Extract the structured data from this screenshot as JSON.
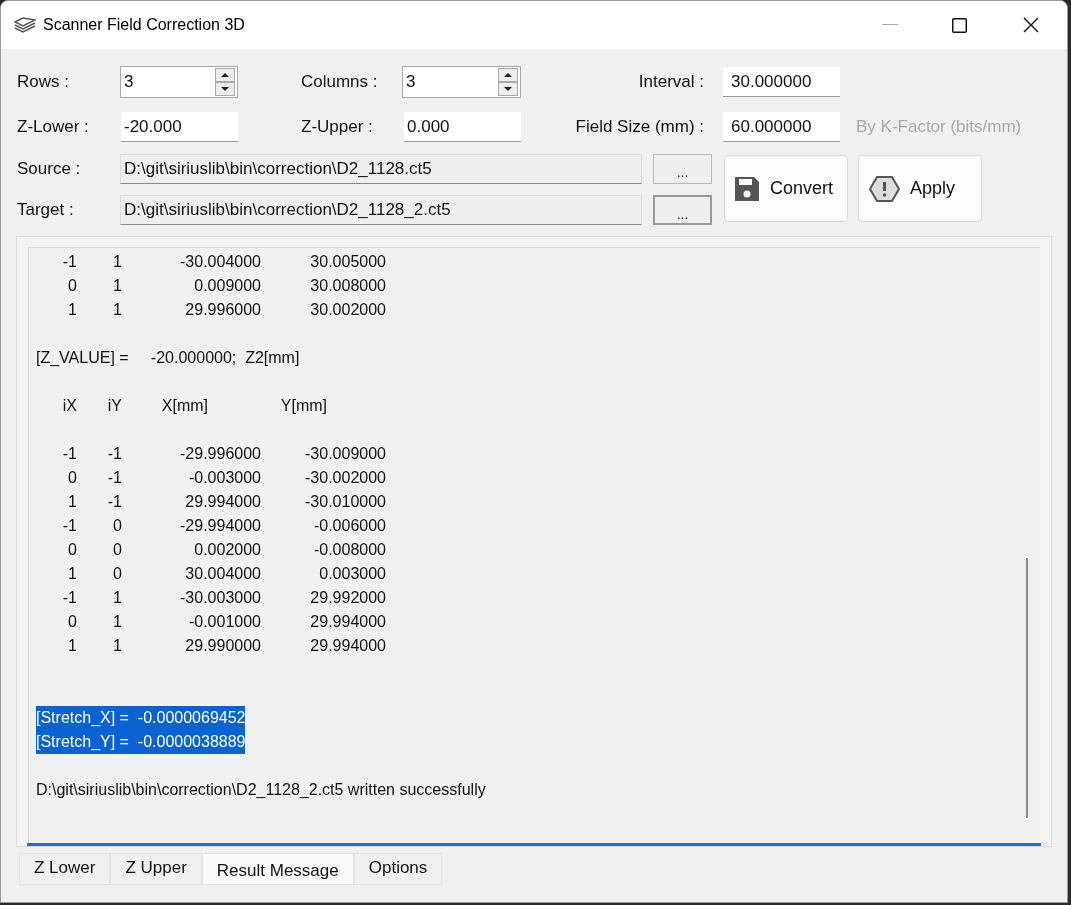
{
  "window": {
    "title": "Scanner Field Correction 3D"
  },
  "form": {
    "rows": {
      "label": "Rows :",
      "value": "3"
    },
    "columns": {
      "label": "Columns :",
      "value": "3"
    },
    "interval": {
      "label": "Interval :",
      "value": "30.000000"
    },
    "z_lower": {
      "label": "Z-Lower :",
      "value": "-20.000"
    },
    "z_upper": {
      "label": "Z-Upper :",
      "value": "0.000"
    },
    "field_size": {
      "label": "Field Size (mm) :",
      "value": "60.000000"
    },
    "k_factor_note": {
      "text": "By K-Factor (bits/mm)",
      "disabled": true
    },
    "source": {
      "label": "Source :",
      "value": "D:\\git\\siriuslib\\bin\\correction\\D2_1128.ct5",
      "browse": "...",
      "focused": false
    },
    "target": {
      "label": "Target :",
      "value": "D:\\git\\siriuslib\\bin\\correction\\D2_1128_2.ct5",
      "browse": "...",
      "focused": true
    }
  },
  "buttons": [
    {
      "label": "Convert",
      "kind": "save"
    },
    {
      "label": "Apply",
      "kind": "warning"
    }
  ],
  "log": [
    {
      "kind": "row",
      "cells": [
        "-1",
        "1",
        "-30.004000",
        "30.005000"
      ]
    },
    {
      "kind": "row",
      "cells": [
        "0",
        "1",
        "0.009000",
        "30.008000"
      ]
    },
    {
      "kind": "row",
      "cells": [
        "1",
        "1",
        "29.996000",
        "30.002000"
      ]
    },
    {
      "kind": "blank"
    },
    {
      "kind": "text",
      "text": "[Z_VALUE] =     -20.000000;  Z2[mm]",
      "selected": false
    },
    {
      "kind": "blank"
    },
    {
      "kind": "header",
      "cells": [
        "iX",
        "iY",
        "X[mm]",
        "Y[mm]"
      ]
    },
    {
      "kind": "blank"
    },
    {
      "kind": "row",
      "cells": [
        "-1",
        "-1",
        "-29.996000",
        "-30.009000"
      ]
    },
    {
      "kind": "row",
      "cells": [
        "0",
        "-1",
        "-0.003000",
        "-30.002000"
      ]
    },
    {
      "kind": "row",
      "cells": [
        "1",
        "-1",
        "29.994000",
        "-30.010000"
      ]
    },
    {
      "kind": "row",
      "cells": [
        "-1",
        "0",
        "-29.994000",
        "-0.006000"
      ]
    },
    {
      "kind": "row",
      "cells": [
        "0",
        "0",
        "0.002000",
        "-0.008000"
      ]
    },
    {
      "kind": "row",
      "cells": [
        "1",
        "0",
        "30.004000",
        "0.003000"
      ]
    },
    {
      "kind": "row",
      "cells": [
        "-1",
        "1",
        "-30.003000",
        "29.992000"
      ]
    },
    {
      "kind": "row",
      "cells": [
        "0",
        "1",
        "-0.001000",
        "29.994000"
      ]
    },
    {
      "kind": "row",
      "cells": [
        "1",
        "1",
        "29.990000",
        "29.994000"
      ]
    },
    {
      "kind": "blank"
    },
    {
      "kind": "blank"
    },
    {
      "kind": "text",
      "text": "[Stretch_X] =  -0.0000069452",
      "selected": true
    },
    {
      "kind": "text",
      "text": "[Stretch_Y] =  -0.0000038889",
      "selected": true
    },
    {
      "kind": "blank"
    },
    {
      "kind": "text",
      "text": "D:\\git\\siriuslib\\bin\\correction\\D2_1128_2.ct5 written successfully",
      "selected": false
    }
  ],
  "tabs": [
    {
      "label": "Z Lower",
      "selected": false
    },
    {
      "label": "Z Upper",
      "selected": false
    },
    {
      "label": "Result Message",
      "selected": true
    },
    {
      "label": "Options",
      "selected": false
    }
  ]
}
